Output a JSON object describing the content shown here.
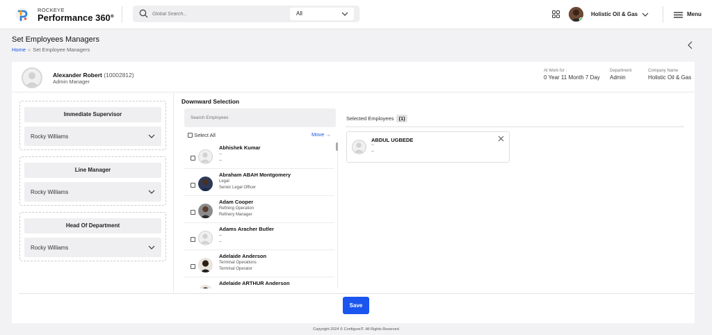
{
  "header": {
    "brand_top": "ROCKEYE",
    "brand_main": "Performance 360°",
    "search_placeholder": "Global Search...",
    "search_scope": "All",
    "company": "Holistic Oil & Gas",
    "menu_label": "Menu"
  },
  "page": {
    "title": "Set Employees Managers",
    "breadcrumb_home": "Home",
    "breadcrumb_sep": "»",
    "breadcrumb_current": "Set Employee Managers"
  },
  "profile": {
    "name": "Alexander Robert",
    "id": "(10002812)",
    "role": "Admin Manager",
    "at_work_label": "At Work for :",
    "at_work_value": "0 Year 11 Month 7 Day",
    "department_label": "Department",
    "department_value": "Admin",
    "company_label": "Company Name",
    "company_value": "Holistic Oil & Gas"
  },
  "managers": [
    {
      "heading": "Immediate Supervisor",
      "value": "Rocky Williams"
    },
    {
      "heading": "Line Manager",
      "value": "Rocky Williams"
    },
    {
      "heading": "Head Of Department",
      "value": "Rocky Williams"
    }
  ],
  "downward": {
    "title": "Downward Selection",
    "search_placeholder": "Search Employees",
    "select_all": "Select All",
    "move_label": "Move →",
    "employees": [
      {
        "name": "Abhishek Kumar",
        "line1": "--",
        "line2": "--",
        "photo": false
      },
      {
        "name": "Abraham ABAH Montgomery",
        "line1": "Legal",
        "line2": "Senior Legal Officer",
        "photo": true
      },
      {
        "name": "Adam Cooper",
        "line1": "Refining Operation",
        "line2": "Refinery Manager",
        "photo": true
      },
      {
        "name": "Adams Aracher Butler",
        "line1": "--",
        "line2": "--",
        "photo": false
      },
      {
        "name": "Adelaide Anderson",
        "line1": "Terminal Operations",
        "line2": "Terminal Operator",
        "photo": true
      },
      {
        "name": "Adelaide ARTHUR Anderson",
        "line1": "",
        "line2": "",
        "photo": true
      }
    ]
  },
  "selected": {
    "title": "Selected Employees",
    "count": "(1)",
    "employees": [
      {
        "name": "ABDUL UGBEDE",
        "line1": "--",
        "line2": "--"
      }
    ]
  },
  "footer": {
    "save_label": "Save",
    "copyright": "Copyright 2024 © ConfigureIT. All Rights Reserved"
  },
  "colors": {
    "accent": "#1a55f0",
    "link": "#1a55e3",
    "online": "#2ec04a"
  }
}
